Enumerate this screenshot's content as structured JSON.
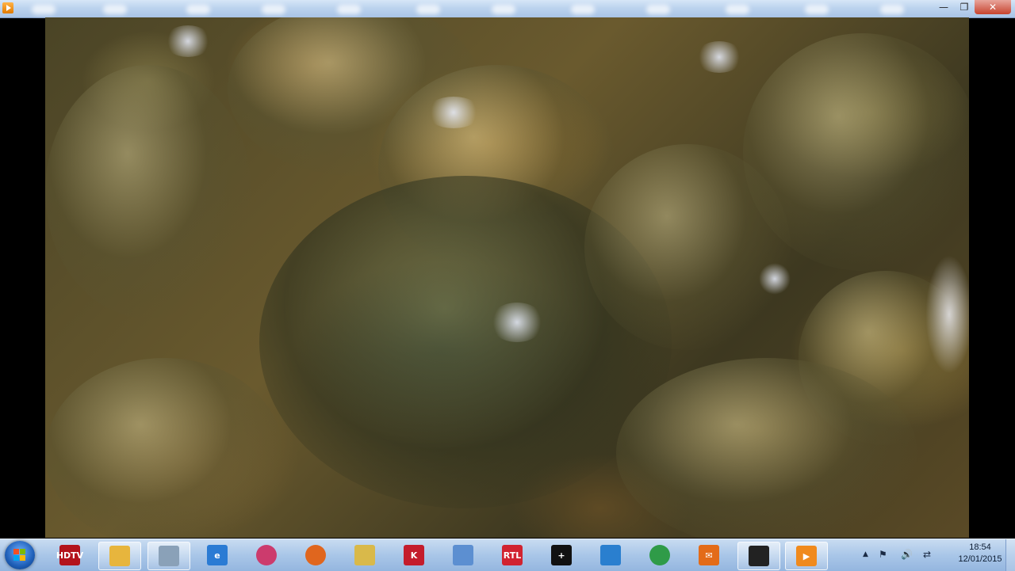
{
  "window": {
    "controls": {
      "minimize": "—",
      "maximize": "❐",
      "close": "✕"
    }
  },
  "taskbar": {
    "pinned": [
      {
        "name": "hdtv",
        "glyph": "HDTV",
        "color": "#b3131c"
      },
      {
        "name": "explorer",
        "glyph": "",
        "color": "#e7b53d"
      },
      {
        "name": "calculator",
        "glyph": "",
        "color": "#8aa1b8"
      },
      {
        "name": "internet-explorer",
        "glyph": "e",
        "color": "#2a7bd4"
      },
      {
        "name": "picasa",
        "glyph": "",
        "color": "#cc3b6d"
      },
      {
        "name": "firefox",
        "glyph": "",
        "color": "#e0661e"
      },
      {
        "name": "notepad",
        "glyph": "",
        "color": "#d9b94a"
      },
      {
        "name": "kaspersky",
        "glyph": "K",
        "color": "#c41c2c"
      },
      {
        "name": "photos",
        "glyph": "",
        "color": "#5c8fd1"
      },
      {
        "name": "rtl",
        "glyph": "RTL",
        "color": "#d12330"
      },
      {
        "name": "plus",
        "glyph": "+",
        "color": "#111111"
      },
      {
        "name": "thunderbird",
        "glyph": "",
        "color": "#2a7fcf"
      },
      {
        "name": "chrome",
        "glyph": "",
        "color": "#2f9b48"
      },
      {
        "name": "mail",
        "glyph": "✉",
        "color": "#e36b18"
      },
      {
        "name": "remote-desktop",
        "glyph": "",
        "color": "#222222"
      },
      {
        "name": "media-player",
        "glyph": "▶",
        "color": "#f08a1d"
      }
    ],
    "tray": {
      "up_arrow": "▲",
      "flag": "⚑",
      "volume": "🔊",
      "network": "⇄"
    },
    "clock": {
      "time": "18:54",
      "date": "12/01/2015"
    }
  }
}
